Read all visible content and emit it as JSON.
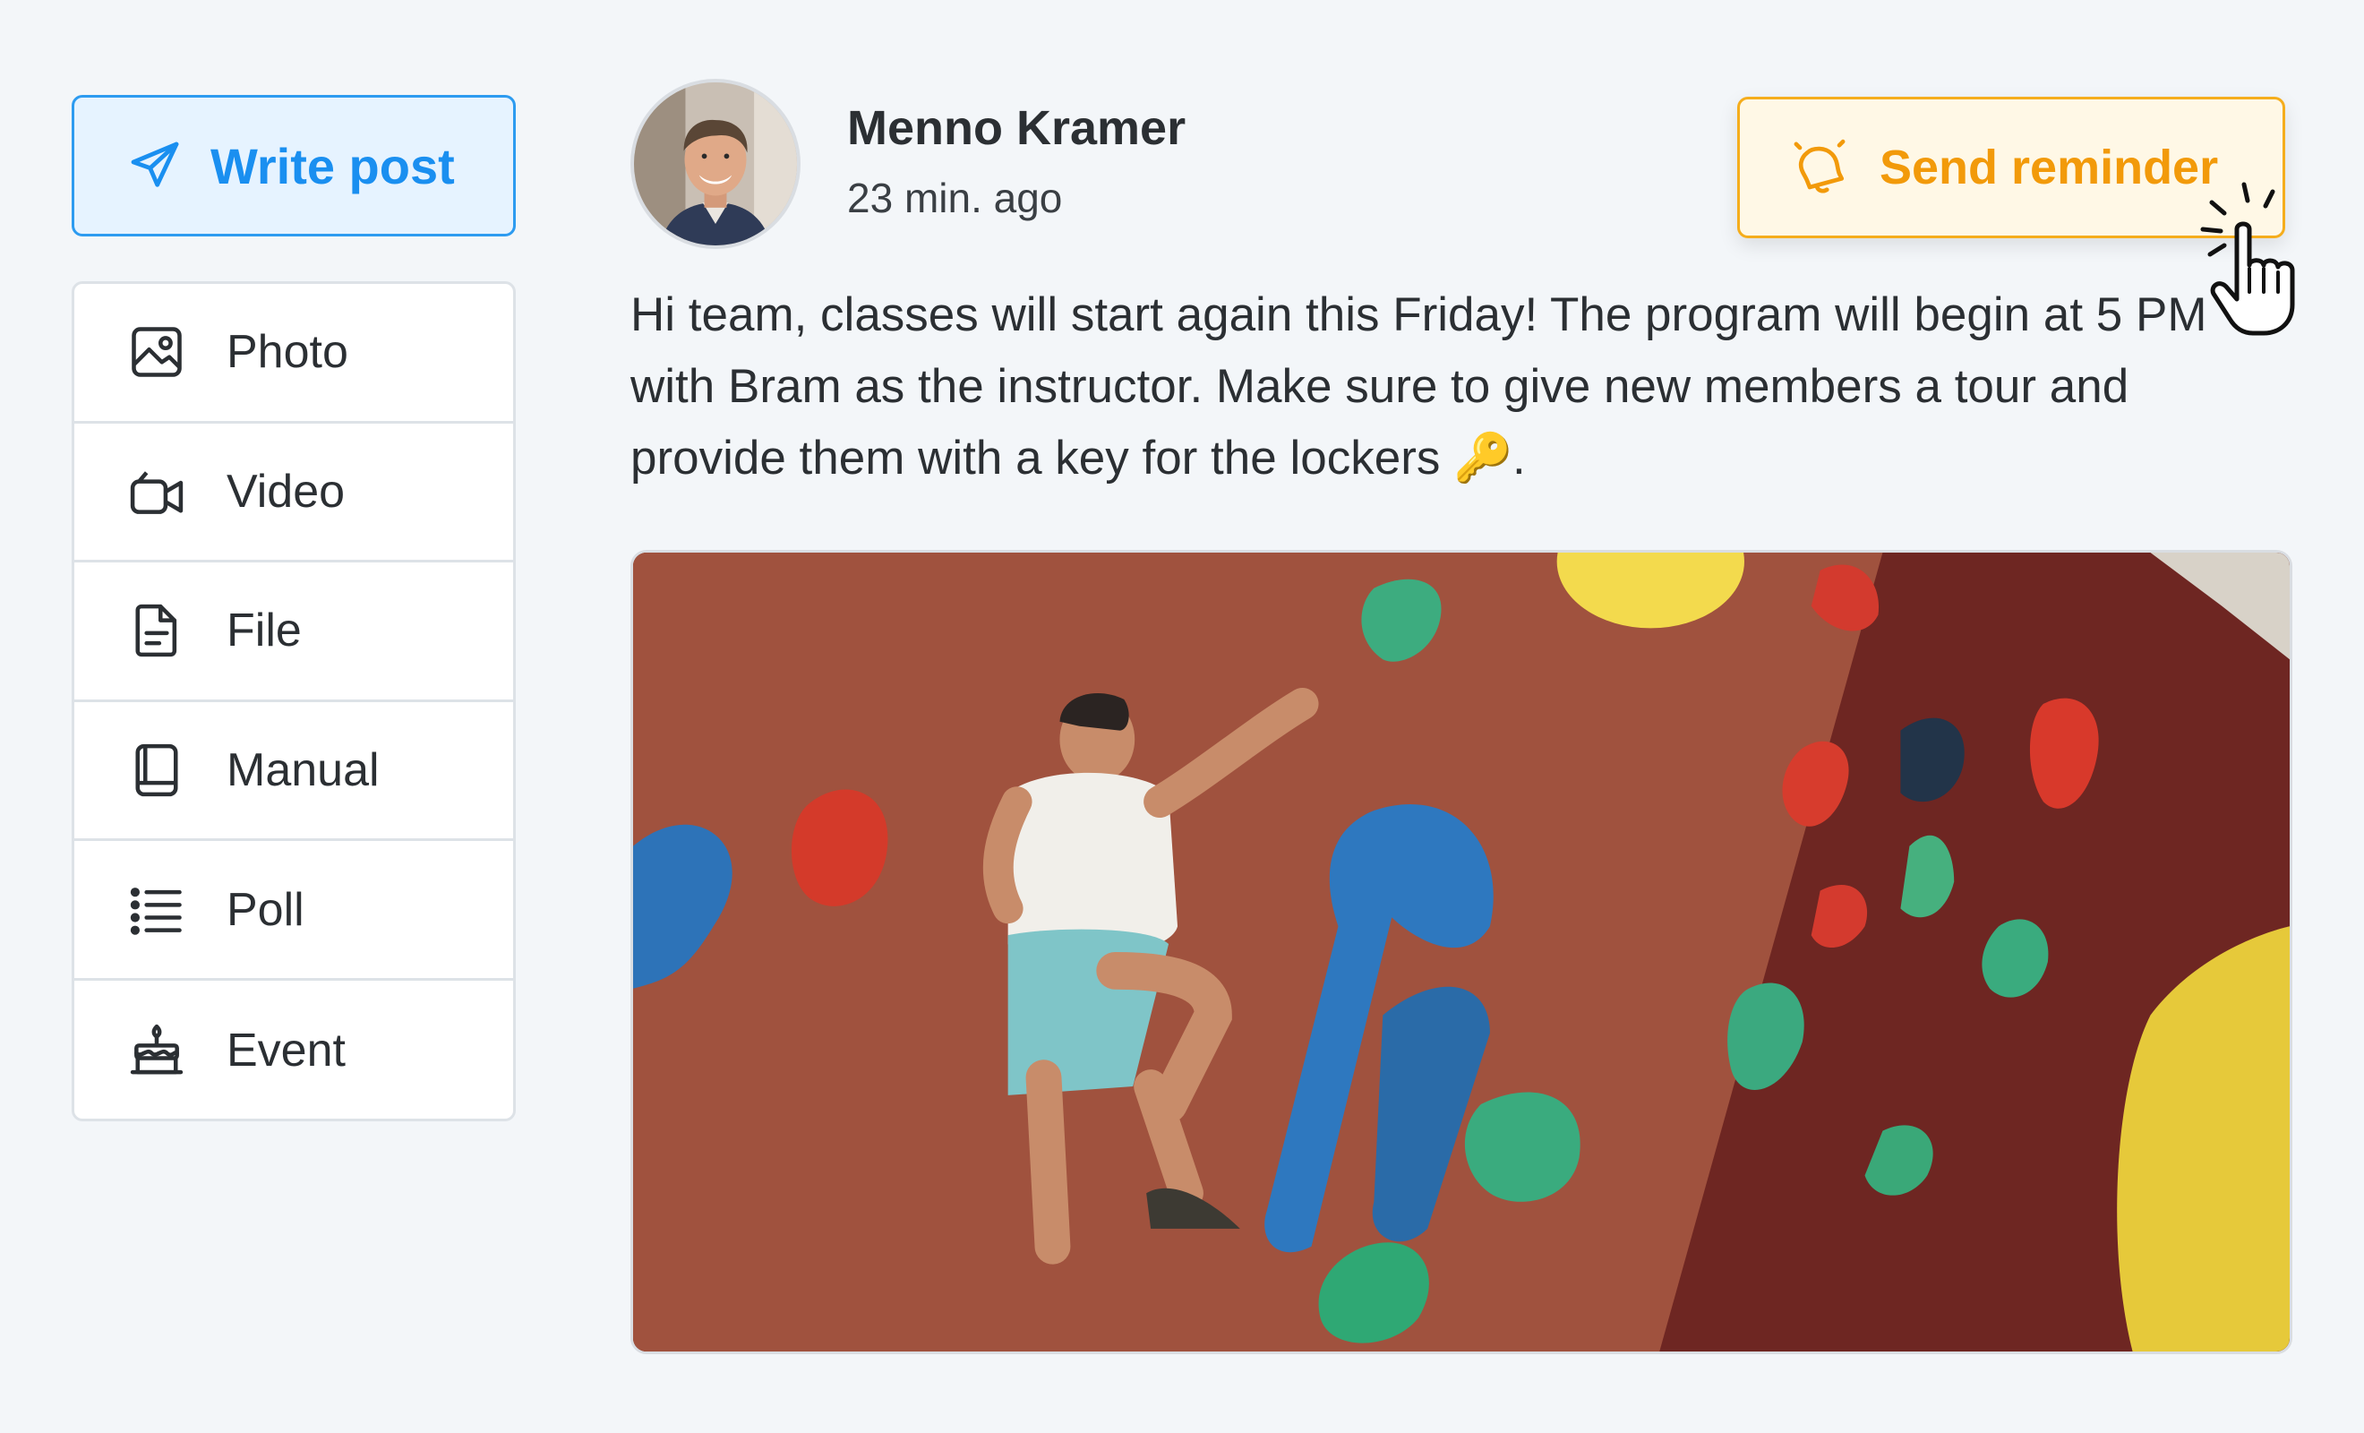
{
  "sidebar": {
    "write_post_label": "Write post",
    "items": [
      {
        "label": "Photo",
        "icon": "photo-icon"
      },
      {
        "label": "Video",
        "icon": "video-icon"
      },
      {
        "label": "File",
        "icon": "file-icon"
      },
      {
        "label": "Manual",
        "icon": "manual-icon"
      },
      {
        "label": "Poll",
        "icon": "poll-icon"
      },
      {
        "label": "Event",
        "icon": "event-cake-icon"
      }
    ]
  },
  "post": {
    "author": "Menno Kramer",
    "time": "23 min. ago",
    "text": "Hi team, classes will start again this Friday! The program will begin at 5 PM with Bram as the instructor. Make sure to give new members a tour and provide them with a key for the lockers 🔑.",
    "reminder_label": "Send reminder"
  },
  "colors": {
    "accent_blue": "#1a8ff0",
    "accent_orange": "#f29a0a",
    "background": "#f3f6f9"
  }
}
